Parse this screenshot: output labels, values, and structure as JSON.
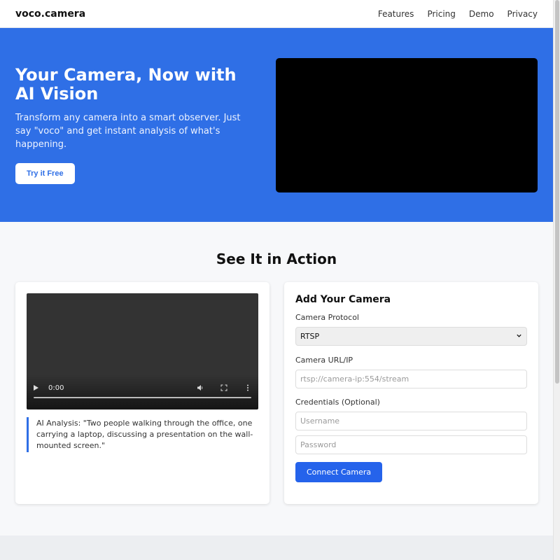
{
  "header": {
    "brand": "voco.camera",
    "nav": [
      "Features",
      "Pricing",
      "Demo",
      "Privacy"
    ]
  },
  "hero": {
    "title": "Your Camera, Now with AI Vision",
    "subtitle": "Transform any camera into a smart observer. Just say \"voco\" and get instant analysis of what's happening.",
    "cta": "Try it Free"
  },
  "demo": {
    "section_title": "See It in Action",
    "player": {
      "time": "0:00"
    },
    "analysis": "AI Analysis: \"Two people walking through the office, one carrying a laptop, discussing a presentation on the wall-mounted screen.\""
  },
  "form": {
    "title": "Add Your Camera",
    "protocol_label": "Camera Protocol",
    "protocol_value": "RTSP",
    "url_label": "Camera URL/IP",
    "url_placeholder": "rtsp://camera-ip:554/stream",
    "credentials_label": "Credentials (Optional)",
    "username_placeholder": "Username",
    "password_placeholder": "Password",
    "connect_label": "Connect Camera"
  },
  "colors": {
    "accent": "#2f6fe6",
    "button": "#2563eb"
  },
  "icons": [
    "play-icon",
    "volume-icon",
    "fullscreen-icon",
    "more-vertical-icon",
    "chevron-down-icon"
  ]
}
